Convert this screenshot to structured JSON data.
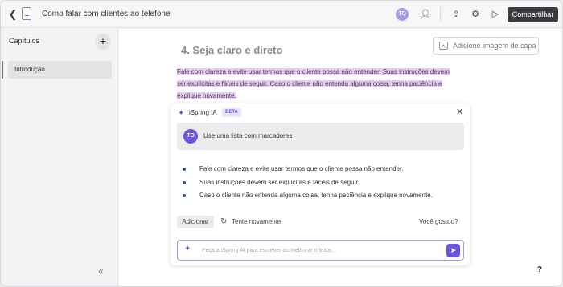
{
  "topbar": {
    "doc_title": "Como falar com clientes ao telefone",
    "avatar_initials": "TO",
    "share_label": "Compartilhar",
    "icons": [
      "chevron-left-icon",
      "document-icon",
      "add-user-icon",
      "upload-icon",
      "gear-icon",
      "play-icon"
    ]
  },
  "sidebar": {
    "title": "Capítulos",
    "items": [
      {
        "label": "Introdução"
      }
    ]
  },
  "main": {
    "cover_button_label": "Adicione imagem de capa",
    "heading": "4. Seja claro e direto",
    "paragraph_lines": [
      "Fale com clareza e evite usar termos que o cliente possa não entender. Suas instruções devem",
      "ser explícitas e fáceis de seguir. Caso o cliente não entenda alguma coisa, tenha paciência e",
      "explique novamente."
    ]
  },
  "ai_panel": {
    "name": "iSpring IA",
    "badge": "BETA",
    "prompt_avatar": "TO",
    "prompt": "Use uma lista com marcadores",
    "bullets": [
      "Fale com clareza e evite usar termos que o cliente possa não entender.",
      "Suas instruções devem ser explícitas e fáceis de seguir.",
      "Caso o cliente não entenda alguma coisa, tenha paciência e explique novamente."
    ],
    "add_label": "Adicionar",
    "retry_label": "Tente novamente",
    "feedback_label": "Você gostou?",
    "input_placeholder": "Peça à iSpring AI para escrever ou melhorar o texto..."
  },
  "colors": {
    "accent": "#6b54e0",
    "highlight": "#e9c9f4",
    "share_button": "#3a3b40"
  }
}
